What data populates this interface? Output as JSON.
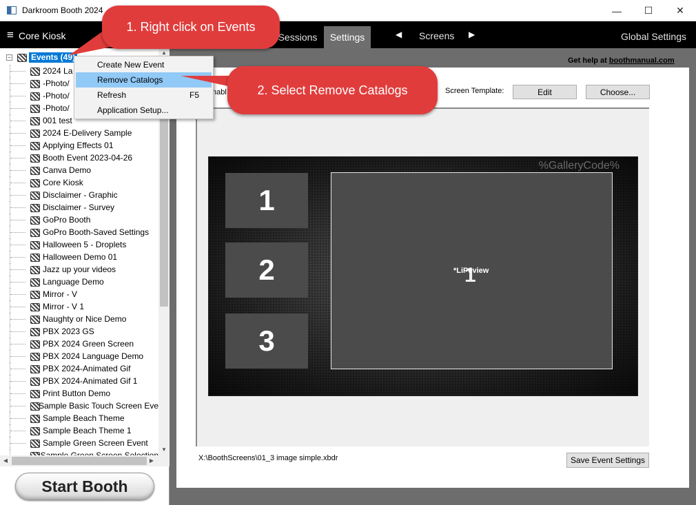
{
  "window": {
    "title": "Darkroom Booth 2024",
    "minimize": "—",
    "maximize": "☐",
    "close": "✕"
  },
  "menubar": {
    "menu_icon": "≡",
    "kiosk_label": "Core Kiosk",
    "tabs": [
      {
        "label": "Sessions"
      },
      {
        "label": "Settings"
      }
    ],
    "prev_arrow": "◀",
    "screens_label": "Screens",
    "next_arrow": "▶",
    "global_settings": "Global Settings"
  },
  "tree": {
    "expander": "−",
    "root_label": "Events (49)",
    "items": [
      "2024 La",
      "-Photo/",
      "-Photo/",
      "-Photo/",
      "001 test",
      "2024 E-Delivery Sample",
      "Applying Effects 01",
      "Booth Event 2023-04-26",
      "Canva Demo",
      "Core Kiosk",
      "Disclaimer - Graphic",
      "Disclaimer - Survey",
      "GoPro Booth",
      "GoPro Booth-Saved Settings",
      "Halloween 5 - Droplets",
      "Halloween Demo 01",
      "Jazz up your videos",
      "Language Demo",
      "Mirror - V",
      "Mirror - V  1",
      "Naughty or Nice Demo",
      "PBX 2023 GS",
      "PBX 2024 Green Screen",
      "PBX 2024 Language Demo",
      "PBX 2024-Animated Gif",
      "PBX 2024-Animated Gif  1",
      "Print Button Demo",
      "Sample Basic Touch Screen Eve",
      "Sample Beach Theme",
      "Sample Beach Theme  1",
      "Sample Green Screen Event",
      "Sample Green Screen Selection"
    ],
    "scroll_up": "▲",
    "scroll_down": "▼",
    "scroll_left": "◀",
    "scroll_right": "▶"
  },
  "start_booth": "Start Booth",
  "main": {
    "help_prefix": "Get help at ",
    "help_site": "boothmanual.com",
    "enable_text": "nabl",
    "screen_template_label": "Screen Template:",
    "edit_button": "Edit",
    "choose_button": "Choose...",
    "gallery_code": "%GalleryCode%",
    "thumbs": [
      "1",
      "2",
      "3"
    ],
    "live_number": "1",
    "live_label": "*LiPeview",
    "file_path": "X:\\BoothScreens\\01_3 image simple.xbdr",
    "save_button": "Save Event Settings"
  },
  "context_menu": {
    "items": [
      {
        "label": "Create New Event",
        "shortcut": ""
      },
      {
        "label": "Remove Catalogs",
        "shortcut": ""
      },
      {
        "label": "Refresh",
        "shortcut": "F5"
      },
      {
        "label": "Application Setup...",
        "shortcut": ""
      }
    ]
  },
  "callouts": {
    "step1": "1. Right click on Events",
    "step2": "2. Select Remove Catalogs"
  },
  "colors": {
    "callout": "#e13c3c",
    "selection": "#0078d7",
    "menu_highlight": "#91c9f7"
  }
}
